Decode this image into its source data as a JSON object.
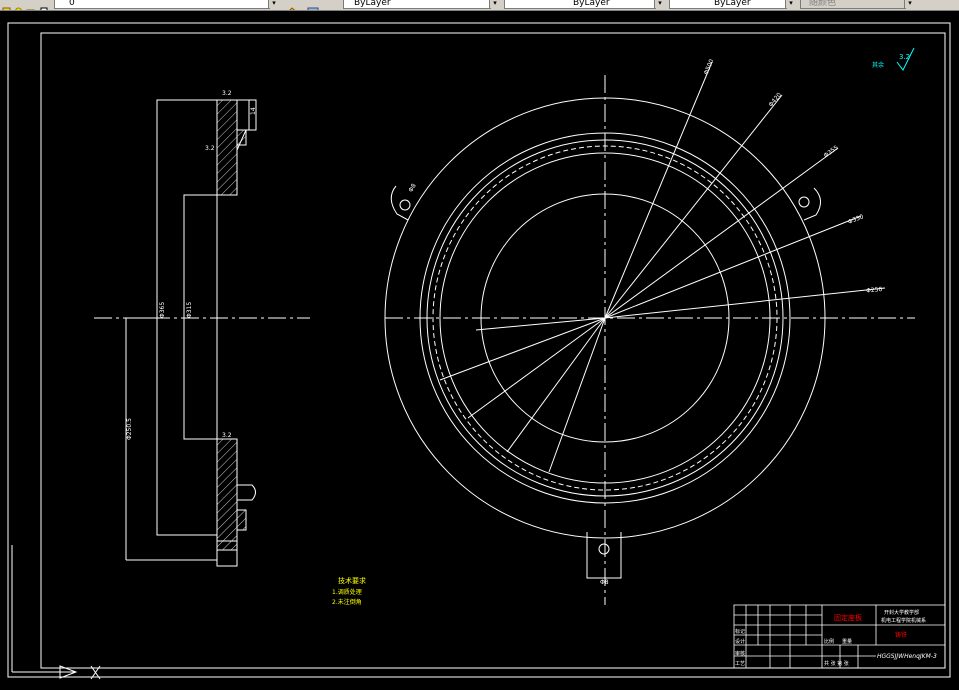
{
  "toolbar": {
    "layer_value": "0",
    "color_value": "ByLayer",
    "linetype_value": "ByLayer",
    "lineweight_value": "ByLayer",
    "plotstyle_value": "随颜色"
  },
  "drawing": {
    "surface_note": "其余",
    "surface_value": "3.2",
    "tech_req_title": "技术要求",
    "tech_req_1": "1.调质处理",
    "tech_req_2": "2.未注倒角",
    "dim_side_1": "Φ365",
    "dim_side_2": "Φ315",
    "dim_side_3": "Φ250.5",
    "dim_side_4": "14",
    "rough_side_1": "3.2",
    "rough_side_2": "3.2",
    "rough_side_3": "3.2",
    "dim_front_1": "Φ500",
    "dim_front_2": "Φ420",
    "dim_front_3": "Φ355",
    "dim_front_4": "Φ330",
    "dim_front_5": "Φ250",
    "dim_hole_1": "Φ8",
    "dim_hole_2": "Φ8"
  },
  "title_block": {
    "part_name": "固定座板",
    "school_line1": "开封大学教学部",
    "school_line2": "机电工程学院机械系",
    "material": "铸铁",
    "drawing_no": "HGGSJJWHenqJKM-3",
    "cells": {
      "r1": "标记",
      "r2": "设计",
      "r3": "审核",
      "r4": "工艺",
      "scale_label": "比例",
      "weight_label": "重量",
      "sheet_label": "共 张 第 张"
    }
  }
}
